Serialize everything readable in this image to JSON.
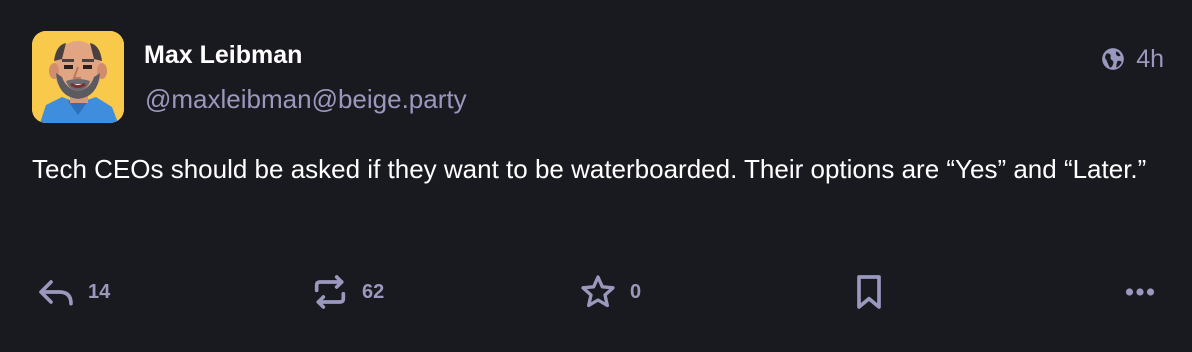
{
  "author": {
    "display_name": "Max Leibman",
    "handle": "@maxleibman@beige.party",
    "avatar_icon": "pixel-art-portrait"
  },
  "meta": {
    "visibility_icon": "globe-icon",
    "timestamp": "4h"
  },
  "post": {
    "text": "Tech CEOs should be asked if they want to be waterboarded. Their options are “Yes” and “Later.”"
  },
  "actions": {
    "reply_count": "14",
    "boost_count": "62",
    "favourite_count": "0"
  },
  "colors": {
    "background": "#191920",
    "text_primary": "#ffffff",
    "text_secondary": "#9a98bd",
    "avatar_background": "#f8c94a"
  }
}
